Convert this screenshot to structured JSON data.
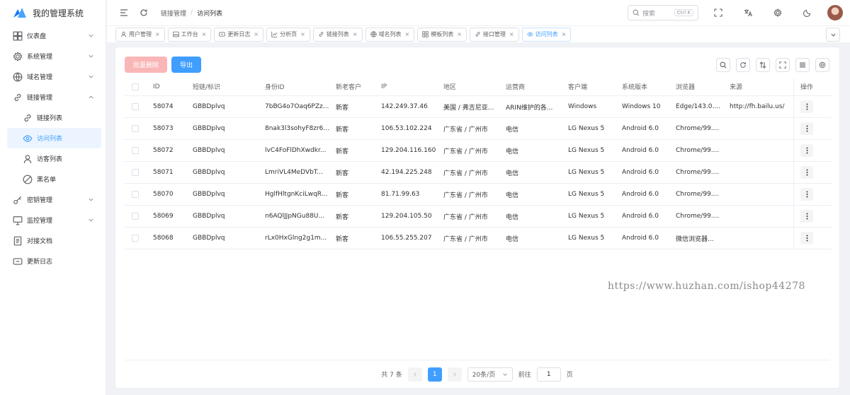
{
  "app": {
    "title": "我的管理系统"
  },
  "sidebar": {
    "items": [
      {
        "label": "仪表盘",
        "icon": "dashboard-icon",
        "expand": "down"
      },
      {
        "label": "系统管理",
        "icon": "gear-icon",
        "expand": "down"
      },
      {
        "label": "域名管理",
        "icon": "globe-icon",
        "expand": "down"
      },
      {
        "label": "链接管理",
        "icon": "link-icon",
        "expand": "up"
      }
    ],
    "sub_items": [
      {
        "label": "链接列表",
        "icon": "link-icon"
      },
      {
        "label": "访问列表",
        "icon": "eye-icon",
        "active": true
      },
      {
        "label": "访客列表",
        "icon": "user-icon"
      },
      {
        "label": "黑名单",
        "icon": "ban-icon"
      }
    ],
    "items2": [
      {
        "label": "密钥管理",
        "icon": "key-icon",
        "expand": "down"
      },
      {
        "label": "监控管理",
        "icon": "monitor-icon",
        "expand": "down"
      },
      {
        "label": "对接文档",
        "icon": "document-icon"
      },
      {
        "label": "更新日志",
        "icon": "log-icon"
      }
    ]
  },
  "header": {
    "breadcrumb": [
      "链接管理",
      "访问列表"
    ],
    "breadcrumb_sep": "/",
    "search_placeholder": "搜索",
    "search_shortcut": "Ctrl K"
  },
  "tabs": [
    {
      "label": "用户管理",
      "icon": "user-icon"
    },
    {
      "label": "工作台",
      "icon": "image-icon"
    },
    {
      "label": "更新日志",
      "icon": "log-icon"
    },
    {
      "label": "分析页",
      "icon": "chart-icon"
    },
    {
      "label": "链接列表",
      "icon": "link-icon"
    },
    {
      "label": "域名列表",
      "icon": "globe-icon"
    },
    {
      "label": "模板列表",
      "icon": "grid-icon"
    },
    {
      "label": "接口管理",
      "icon": "link-icon"
    },
    {
      "label": "访问列表",
      "icon": "eye-icon",
      "active": true
    }
  ],
  "toolbar": {
    "batch_delete": "批量删除",
    "export": "导出"
  },
  "table": {
    "headers": [
      "ID",
      "短链/标识",
      "身份ID",
      "新老客户",
      "IP",
      "地区",
      "运营商",
      "客户端",
      "系统版本",
      "浏览器",
      "来源",
      "操作"
    ],
    "rows": [
      [
        "58074",
        "GBBDplvq",
        "7bBG4o7Oaq6PZz...",
        "新客",
        "142.249.37.46",
        "美国 / 弗吉尼亚...",
        "ARIN维护的各...",
        "Windows",
        "Windows 10",
        "Edge/143.0....",
        "http://fh.bailu.us/"
      ],
      [
        "58073",
        "GBBDplvq",
        "8nak3l3sohyF8zr6...",
        "新客",
        "106.53.102.224",
        "广东省 / 广州市",
        "电信",
        "LG Nexus 5",
        "Android 6.0",
        "Chrome/99....",
        ""
      ],
      [
        "58072",
        "GBBDplvq",
        "lvC4FoFlDhXwdkr...",
        "新客",
        "129.204.116.160",
        "广东省 / 广州市",
        "电信",
        "LG Nexus 5",
        "Android 6.0",
        "Chrome/99....",
        ""
      ],
      [
        "58071",
        "GBBDplvq",
        "LmriVL4MeDVbT...",
        "新客",
        "42.194.225.248",
        "广东省 / 广州市",
        "电信",
        "LG Nexus 5",
        "Android 6.0",
        "Chrome/99....",
        ""
      ],
      [
        "58070",
        "GBBDplvq",
        "HglfHltgnKciLwqR...",
        "新客",
        "81.71.99.63",
        "广东省 / 广州市",
        "电信",
        "LG Nexus 5",
        "Android 6.0",
        "Chrome/99....",
        ""
      ],
      [
        "58069",
        "GBBDplvq",
        "n6AQlJJpNGu88U...",
        "新客",
        "129.204.105.50",
        "广东省 / 广州市",
        "电信",
        "LG Nexus 5",
        "Android 6.0",
        "Chrome/99....",
        ""
      ],
      [
        "58068",
        "GBBDplvq",
        "rLx0HxGlng2g1m...",
        "新客",
        "106.55.255.207",
        "广东省 / 广州市",
        "电信",
        "LG Nexus 5",
        "Android 6.0",
        "微信浏览器...",
        ""
      ]
    ]
  },
  "pagination": {
    "total": "共 7 条",
    "current_page": "1",
    "page_size": "20条/页",
    "goto_label": "前往",
    "goto_value": "1",
    "page_suffix": "页"
  },
  "watermark": "https://www.huzhan.com/ishop44278",
  "colors": {
    "primary": "#409eff",
    "danger_light": "#fab6b6"
  }
}
